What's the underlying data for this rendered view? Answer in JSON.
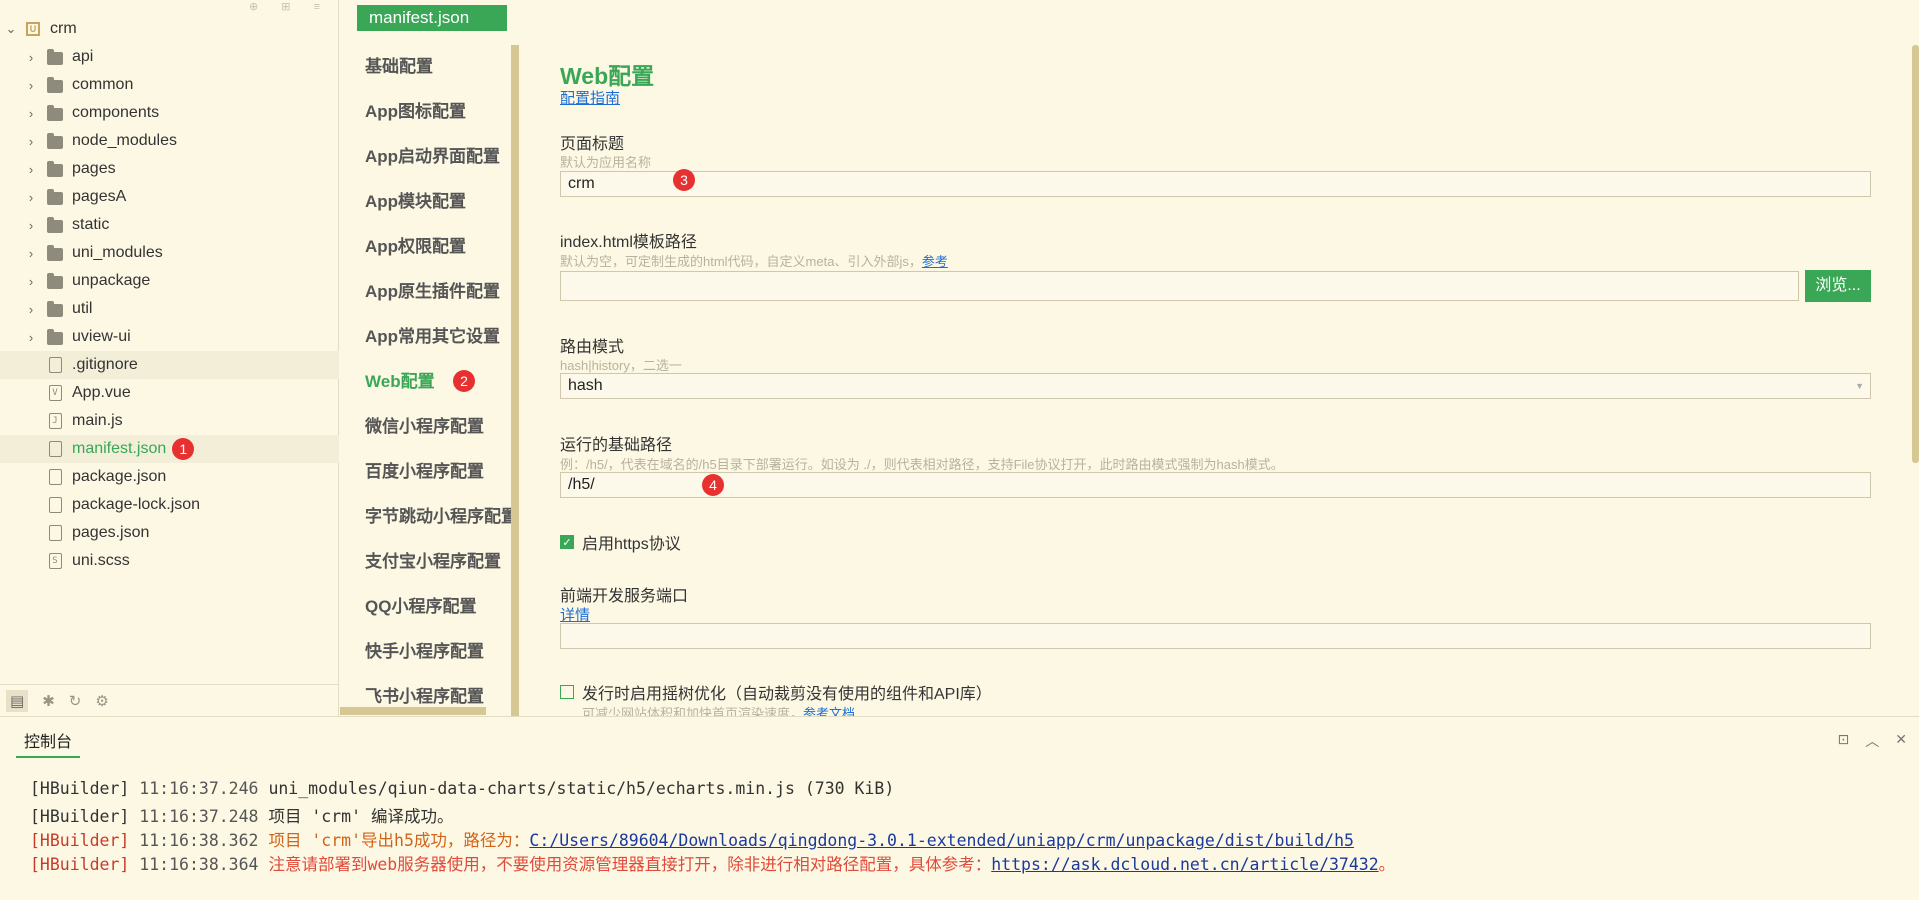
{
  "explorer": {
    "project": "crm",
    "items": [
      {
        "label": "api",
        "type": "folder"
      },
      {
        "label": "common",
        "type": "folder"
      },
      {
        "label": "components",
        "type": "folder"
      },
      {
        "label": "node_modules",
        "type": "folder"
      },
      {
        "label": "pages",
        "type": "folder"
      },
      {
        "label": "pagesA",
        "type": "folder"
      },
      {
        "label": "static",
        "type": "folder"
      },
      {
        "label": "uni_modules",
        "type": "folder"
      },
      {
        "label": "unpackage",
        "type": "folder"
      },
      {
        "label": "util",
        "type": "folder"
      },
      {
        "label": "uview-ui",
        "type": "folder"
      },
      {
        "label": ".gitignore",
        "type": "file"
      },
      {
        "label": "App.vue",
        "type": "file"
      },
      {
        "label": "main.js",
        "type": "file"
      },
      {
        "label": "manifest.json",
        "type": "file"
      },
      {
        "label": "package.json",
        "type": "file"
      },
      {
        "label": "package-lock.json",
        "type": "file"
      },
      {
        "label": "pages.json",
        "type": "file"
      },
      {
        "label": "uni.scss",
        "type": "file"
      }
    ],
    "badge1": "1"
  },
  "editor": {
    "tab_label": "manifest.json"
  },
  "nav": {
    "items": [
      "基础配置",
      "App图标配置",
      "App启动界面配置",
      "App模块配置",
      "App权限配置",
      "App原生插件配置",
      "App常用其它设置",
      "Web配置",
      "微信小程序配置",
      "百度小程序配置",
      "字节跳动小程序配置",
      "支付宝小程序配置",
      "QQ小程序配置",
      "快手小程序配置",
      "飞书小程序配置"
    ],
    "badge2": "2"
  },
  "web": {
    "title": "Web配置",
    "guide_link": "配置指南",
    "page_title_label": "页面标题",
    "page_title_hint": "默认为应用名称",
    "page_title_value": "crm",
    "badge3": "3",
    "template_label": "index.html模板路径",
    "template_hint": "默认为空，可定制生成的html代码，自定义meta、引入外部js，",
    "template_hint_link": "参考",
    "template_value": "",
    "browse_button": "浏览...",
    "router_label": "路由模式",
    "router_hint": "hash|history，二选一",
    "router_value": "hash",
    "base_label": "运行的基础路径",
    "base_hint": "例：/h5/，代表在域名的/h5目录下部署运行。如设为 ./，则代表相对路径，支持File协议打开，此时路由模式强制为hash模式。",
    "base_value": "/h5/",
    "badge4": "4",
    "https_label": "启用https协议",
    "https_checked": true,
    "port_label": "前端开发服务端口",
    "port_link": "详情",
    "port_value": "",
    "treeshake_label": "发行时启用摇树优化（自动裁剪没有使用的组件和API库）",
    "treeshake_checked": false,
    "treeshake_hint": "可减少网站体积和加快首页渲染速度，",
    "treeshake_link": "参考文档"
  },
  "console": {
    "title": "控制台",
    "lines": [
      {
        "tag": "[HBuilder]",
        "time": "11:16:37.246",
        "msg": "  uni_modules/qiun-data-charts/static/h5/echarts.min.js (730 KiB)",
        "url": "",
        "tail": "",
        "level": "info"
      },
      {
        "tag": "[HBuilder]",
        "time": "11:16:37.248",
        "msg": "项目 'crm' 编译成功。",
        "url": "",
        "tail": "",
        "level": "info"
      },
      {
        "tag": "[HBuilder]",
        "time": "11:16:38.362",
        "msg": "项目 'crm'导出h5成功，路径为：",
        "url": "C:/Users/89604/Downloads/qingdong-3.0.1-extended/uniapp/crm/unpackage/dist/build/h5",
        "tail": "",
        "level": "warn"
      },
      {
        "tag": "[HBuilder]",
        "time": "11:16:38.364",
        "msg": "注意请部署到web服务器使用，不要使用资源管理器直接打开，除非进行相对路径配置，具体参考：",
        "url": "https://ask.dcloud.net.cn/article/37432",
        "tail": "。",
        "level": "err"
      }
    ]
  }
}
